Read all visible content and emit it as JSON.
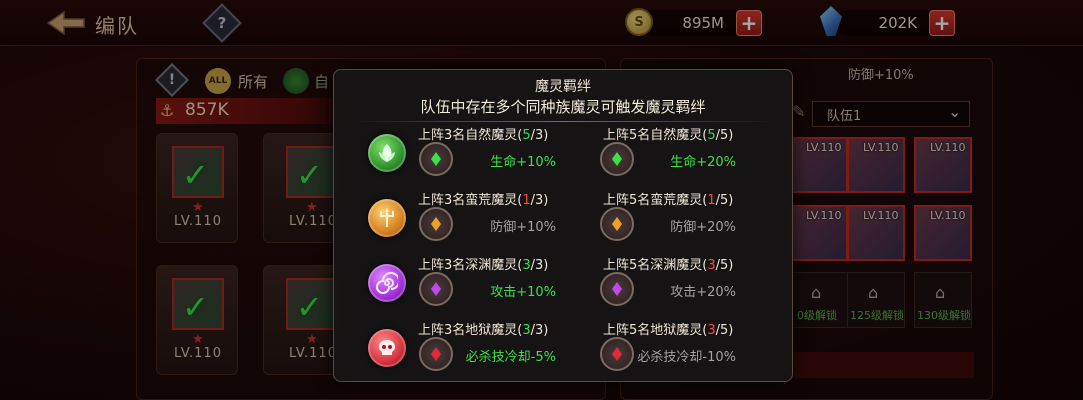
{
  "header": {
    "title": "编队",
    "help_glyph": "?",
    "gold": "895M",
    "gold_icon_glyph": "S",
    "gems": "202K",
    "plus_glyph": "+"
  },
  "filters": {
    "warn_glyph": "!",
    "all_badge": "ALL",
    "all_label": "所有",
    "nature_label": "自"
  },
  "power": {
    "value": "857K"
  },
  "roster": {
    "cards": [
      {
        "level": "LV.110"
      },
      {
        "level": "LV.110"
      },
      {
        "level": "LV.110"
      },
      {
        "level": "LV.110"
      }
    ]
  },
  "team": {
    "defense_text": "防御+10%",
    "selected_team": "队伍1",
    "slots": [
      {
        "level": "LV.110"
      },
      {
        "level": "LV.110"
      },
      {
        "level": "LV.110"
      },
      {
        "level": "LV.110"
      },
      {
        "level": "LV.110"
      },
      {
        "level": "LV.110"
      }
    ],
    "locked_slots": [
      {
        "label": "0级解锁"
      },
      {
        "label": "125级解锁"
      },
      {
        "label": "130级解锁"
      }
    ]
  },
  "modal": {
    "title": "魔灵羁绊",
    "subtitle": "队伍中存在多个同种族魔灵可触发魔灵羁绊",
    "rows": [
      {
        "race": "nature",
        "icon": "leaf-icon",
        "color": "#3ee04a",
        "tier1": {
          "text": "上阵3名自然魔灵(",
          "count": "5",
          "total": "/3)",
          "bonus": "生命+10%",
          "active": true
        },
        "tier2": {
          "text": "上阵5名自然魔灵(",
          "count": "5",
          "total": "/5)",
          "bonus": "生命+20%",
          "active": true
        }
      },
      {
        "race": "wild",
        "icon": "trident-icon",
        "color": "#f0a028",
        "tier1": {
          "text": "上阵3名蛮荒魔灵(",
          "count": "1",
          "total": "/3)",
          "bonus": "防御+10%",
          "active": false
        },
        "tier2": {
          "text": "上阵5名蛮荒魔灵(",
          "count": "1",
          "total": "/5)",
          "bonus": "防御+20%",
          "active": false
        }
      },
      {
        "race": "abyss",
        "icon": "spiral-icon",
        "color": "#c04ae8",
        "tier1": {
          "text": "上阵3名深渊魔灵(",
          "count": "3",
          "total": "/3)",
          "bonus": "攻击+10%",
          "active": true
        },
        "tier2": {
          "text": "上阵5名深渊魔灵(",
          "count": "3",
          "total": "/5)",
          "bonus": "攻击+20%",
          "active": false
        }
      },
      {
        "race": "hell",
        "icon": "skull-icon",
        "color": "#e02a3a",
        "tier1": {
          "text": "上阵3名地狱魔灵(",
          "count": "3",
          "total": "/3)",
          "bonus": "必杀技冷却-5%",
          "active": true
        },
        "tier2": {
          "text": "上阵5名地狱魔灵(",
          "count": "3",
          "total": "/5)",
          "bonus": "必杀技冷却-10%",
          "active": false
        }
      }
    ]
  }
}
